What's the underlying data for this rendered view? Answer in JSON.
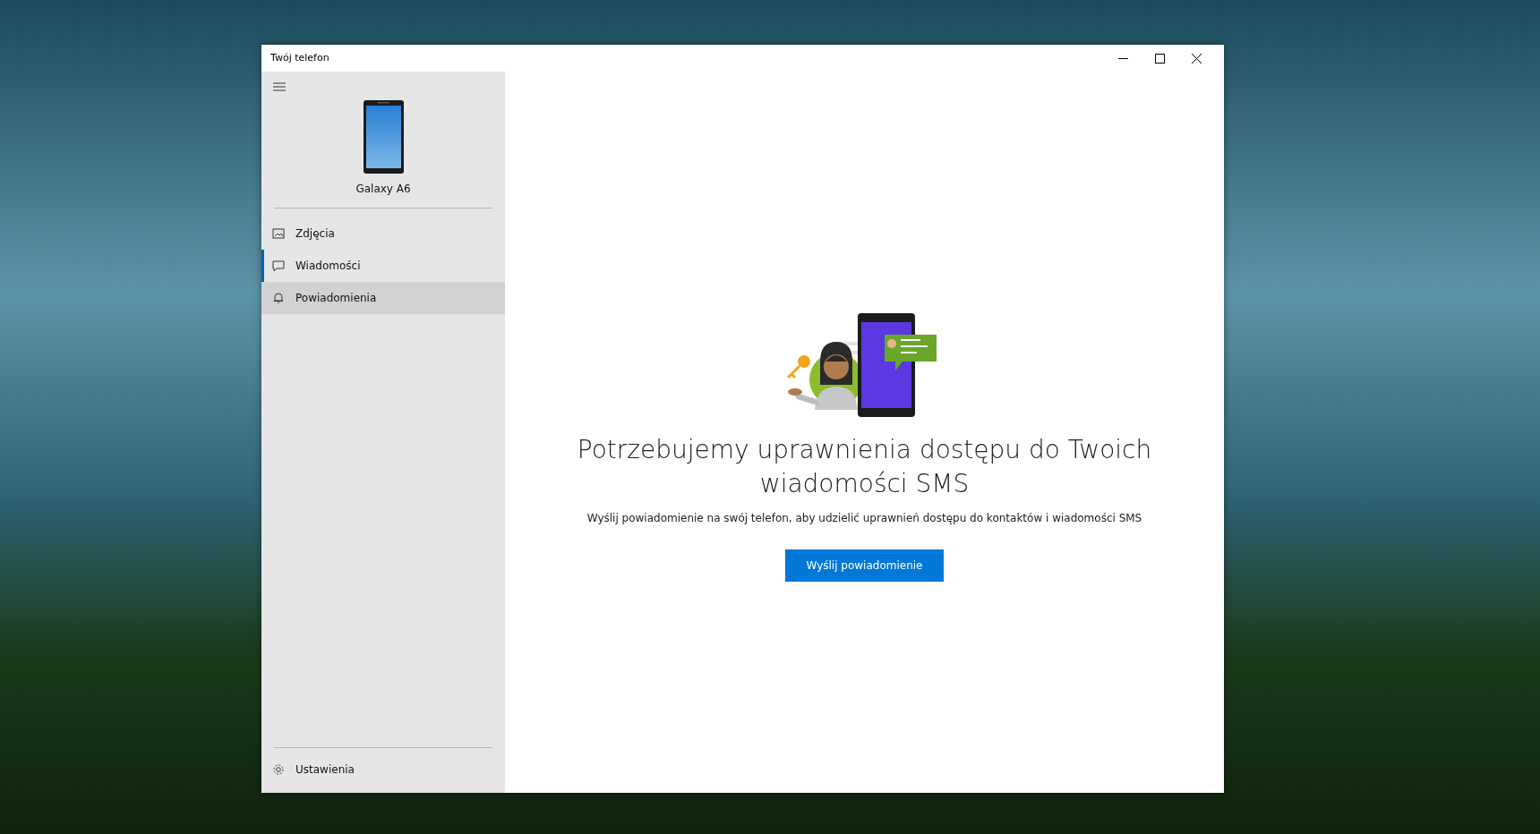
{
  "window": {
    "title": "Twój telefon"
  },
  "device": {
    "name": "Galaxy A6"
  },
  "sidebar": {
    "items": [
      {
        "label": "Zdjęcia",
        "kind": "photos",
        "selected": false,
        "hovered": false
      },
      {
        "label": "Wiadomości",
        "kind": "messages",
        "selected": true,
        "hovered": false
      },
      {
        "label": "Powiadomienia",
        "kind": "notifications",
        "selected": false,
        "hovered": true
      }
    ],
    "footer": {
      "label": "Ustawienia"
    }
  },
  "content": {
    "heading": "Potrzebujemy uprawnienia dostępu do Twoich wiadomości SMS",
    "description": "Wyślij powiadomienie na swój telefon, aby udzielić uprawnień dostępu do kontaktów i wiadomości SMS",
    "button": "Wyślij powiadomienie"
  }
}
